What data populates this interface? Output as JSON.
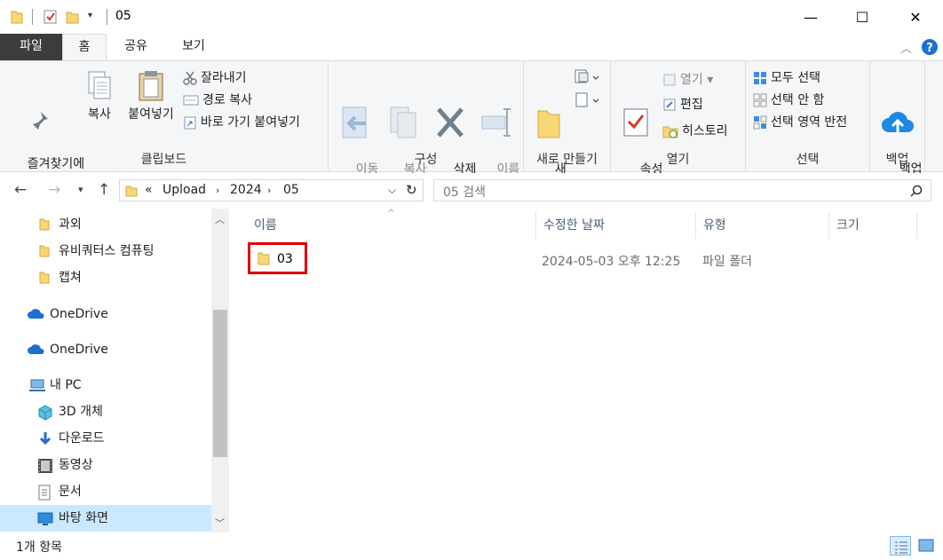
{
  "window": {
    "title": "05",
    "minimize": "—",
    "maximize": "☐",
    "close": "✕"
  },
  "ribbon_tabs": [
    "파일",
    "홈",
    "공유",
    "보기"
  ],
  "ribbon": {
    "clipboard": {
      "pin_label": "즐겨찾기에\n고정",
      "copy_label": "복사",
      "paste_label": "붙여넣기",
      "cut_label": "잘라내기",
      "copy_path_label": "경로 복사",
      "paste_shortcut_label": "바로 가기 붙여넣기",
      "group_label": "클립보드"
    },
    "organize": {
      "move_label": "이동\n위치 ▾",
      "copy_to_label": "복사\n위치 ▾",
      "delete_label": "삭제\n▾",
      "rename_label": "이름\n바꾸기",
      "group_label": "구성"
    },
    "new": {
      "new_folder_label": "새\n폴더",
      "group_label": "새로 만들기"
    },
    "open": {
      "properties_label": "속성\n▾",
      "open_label": "열기 ▾",
      "edit_label": "편집",
      "history_label": "히스토리",
      "group_label": "열기"
    },
    "select": {
      "select_all_label": "모두 선택",
      "select_none_label": "선택 안 함",
      "invert_label": "선택 영역 반전",
      "group_label": "선택"
    },
    "backup": {
      "backup_label": "백업\n시작",
      "group_label": "백업"
    }
  },
  "address": {
    "prefix": "«",
    "crumbs": [
      "Upload",
      "2024",
      "05"
    ],
    "search_placeholder": "05 검색"
  },
  "nav_pane": {
    "items": [
      {
        "label": "과외",
        "icon": "folder-icon"
      },
      {
        "label": "유비쿼터스 컴퓨팅",
        "icon": "folder-icon"
      },
      {
        "label": "캡쳐",
        "icon": "folder-icon"
      },
      {
        "label": "OneDrive",
        "icon": "onedrive-icon"
      },
      {
        "label": "OneDrive",
        "icon": "onedrive-icon"
      },
      {
        "label": "내 PC",
        "icon": "pc-icon"
      },
      {
        "label": "3D 개체",
        "icon": "3d-objects-icon"
      },
      {
        "label": "다운로드",
        "icon": "download-icon"
      },
      {
        "label": "동영상",
        "icon": "video-icon"
      },
      {
        "label": "문서",
        "icon": "document-icon"
      },
      {
        "label": "바탕 화면",
        "icon": "desktop-icon"
      }
    ]
  },
  "file_list": {
    "columns": [
      "이름",
      "수정한 날짜",
      "유형",
      "크기"
    ],
    "rows": [
      {
        "name": "03",
        "modified": "2024-05-03 오후 12:25",
        "type": "파일 폴더",
        "size": ""
      }
    ]
  },
  "status": {
    "count": "1개 항목"
  },
  "colors": {
    "accent": "#0078d7",
    "folder": "#f8d775",
    "highlight": "#e00000",
    "selection": "#cce8ff"
  }
}
